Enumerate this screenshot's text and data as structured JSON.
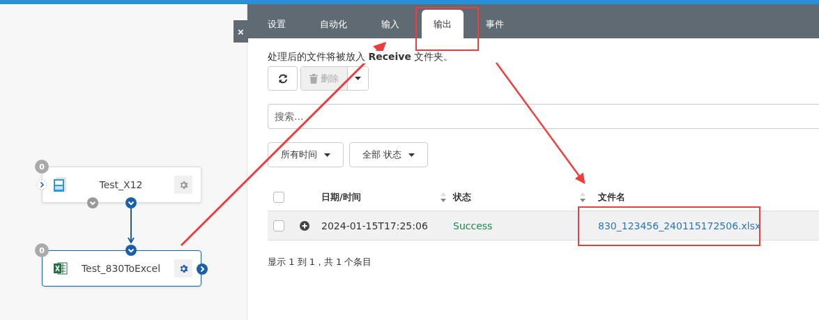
{
  "flow": {
    "nodes": [
      {
        "name": "Test_X12",
        "count": "0",
        "kind": "x12",
        "selected": false
      },
      {
        "name": "Test_830ToExcel",
        "count": "0",
        "kind": "excel",
        "selected": true
      }
    ]
  },
  "close_button": "×",
  "tabs": [
    {
      "label": "设置",
      "selected": false
    },
    {
      "label": "自动化",
      "selected": false
    },
    {
      "label": "输入",
      "selected": false
    },
    {
      "label": "输出",
      "selected": true
    },
    {
      "label": "事件",
      "selected": false
    }
  ],
  "description": "处理后的文件将被放入 **Receive** 文件夹。",
  "toolbar": {
    "delete_label": "删除",
    "delete_disabled": true
  },
  "search": {
    "placeholder": "搜索..."
  },
  "filters": [
    "所有时间",
    "全部 状态"
  ],
  "table": {
    "all_checked": false,
    "columns": [
      {
        "label": "日期/时间",
        "sortable": true
      },
      {
        "label": "状态",
        "sortable": true
      },
      {
        "label": "文件名",
        "sortable": false
      }
    ],
    "rows": [
      {
        "checked": false,
        "date": "2024-01-15T17:25:06",
        "status": "Success",
        "file": "830_123456_240115172506.xlsx"
      }
    ]
  },
  "footer": "显示 1 到 1，共 1 个条目"
}
